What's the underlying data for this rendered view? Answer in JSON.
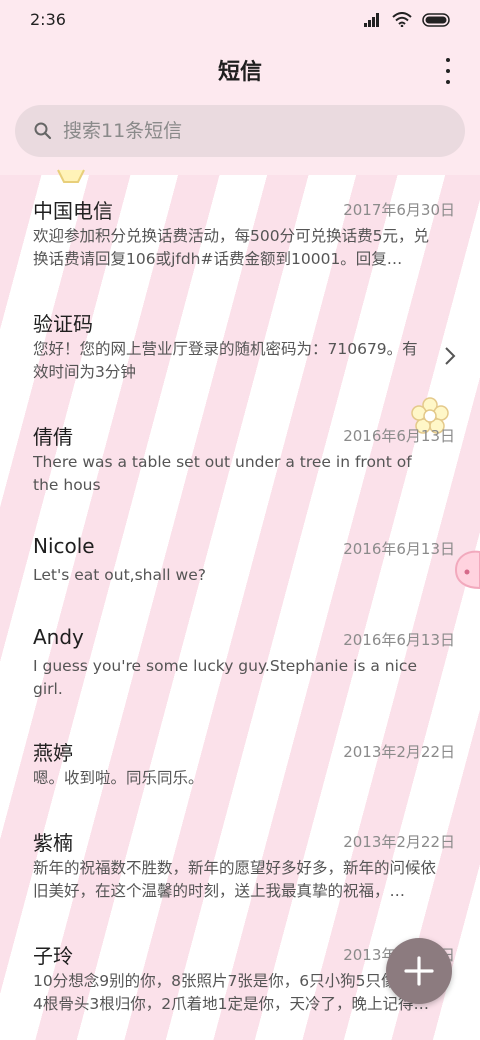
{
  "status_bar": {
    "time": "2:36"
  },
  "header": {
    "title": "短信"
  },
  "search": {
    "placeholder": "搜索11条短信"
  },
  "messages": [
    {
      "sender": "中国电信",
      "date": "2017年6月30日",
      "preview": "欢迎参加积分兑换话费活动，每500分可兑换话费5元，兑换话费请回复106或jfdh#话费金额到10001。回复…"
    },
    {
      "sender": "验证码",
      "date": "",
      "preview": "您好！您的网上营业厅登录的随机密码为：710679。有效时间为3分钟"
    },
    {
      "sender": "倩倩",
      "date": "2016年6月13日",
      "preview": "There was a table set out under a tree in front of the hous"
    },
    {
      "sender": "Nicole",
      "date": "2016年6月13日",
      "preview": "Let's eat out,shall we?"
    },
    {
      "sender": "Andy",
      "date": "2016年6月13日",
      "preview": "I guess you're some lucky guy.Stephanie is a nice girl."
    },
    {
      "sender": "燕婷",
      "date": "2013年2月22日",
      "preview": "嗯。收到啦。同乐同乐。"
    },
    {
      "sender": "紫楠",
      "date": "2013年2月22日",
      "preview": "新年的祝福数不胜数，新年的愿望好多好多，新年的问候依旧美好，在这个温馨的时刻，送上我最真挚的祝福，…"
    },
    {
      "sender": "子玲",
      "date": "2013年2月22日",
      "preview": "10分想念9别的你，8张照片7张是你，6只小狗5只像你，4根骨头3根归你，2爪着地1定是你，天冷了，晚上记得…"
    }
  ],
  "icons": {
    "signal": "signal-icon",
    "wifi": "wifi-icon",
    "battery": "battery-icon",
    "more": "more-vertical-icon",
    "search": "search-icon",
    "chevron": "chevron-right-icon",
    "compose": "plus-icon"
  },
  "colors": {
    "background_pink": "#fde9ef",
    "stripe_pink": "#fbe1ea",
    "search_bg": "#eadadf",
    "fab": "#8c7b7f"
  }
}
